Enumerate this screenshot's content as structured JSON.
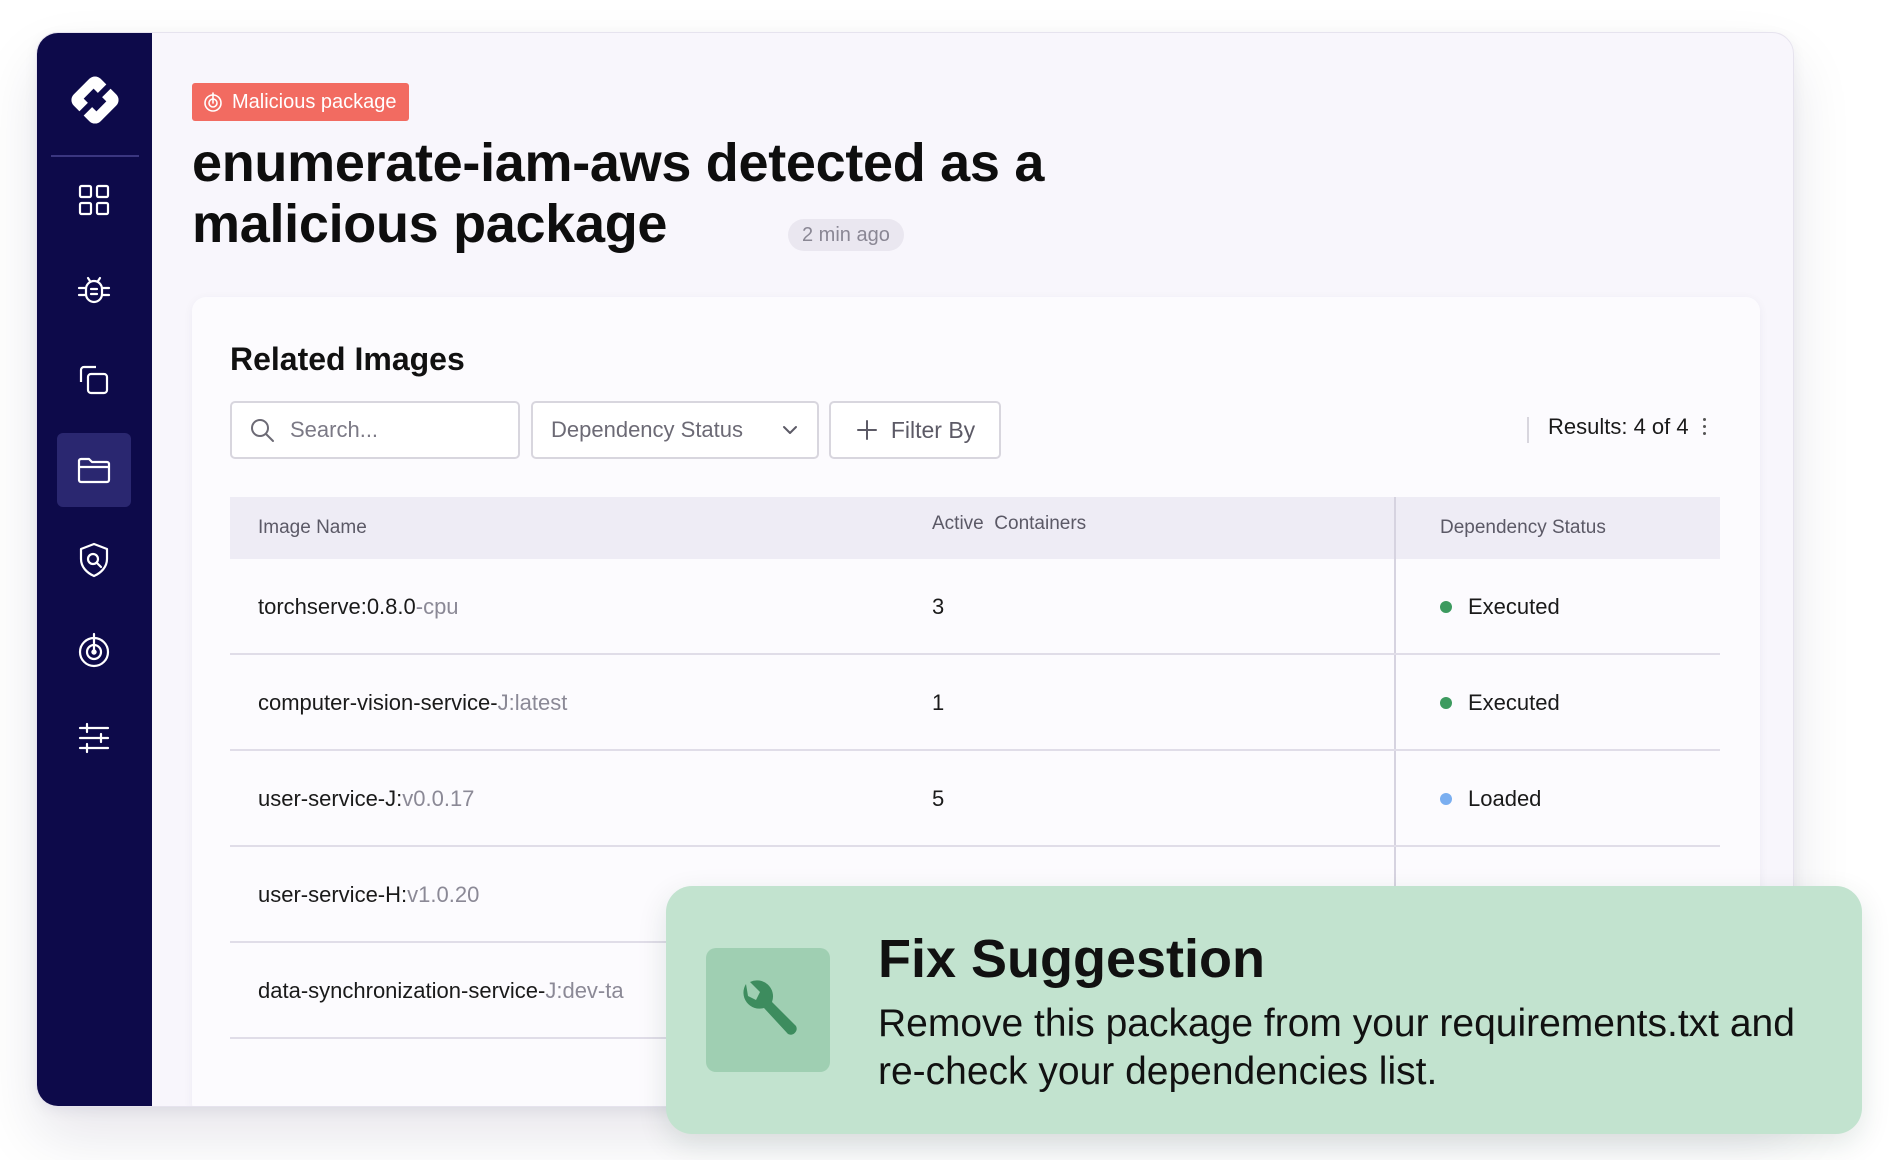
{
  "alert": {
    "badge_label": "Malicious package",
    "title": "enumerate-iam-aws detected as a malicious package",
    "time_ago": "2 min ago"
  },
  "sidebar": {
    "items": [
      {
        "icon": "grid-icon",
        "active": false
      },
      {
        "icon": "bug-icon",
        "active": false
      },
      {
        "icon": "copy-icon",
        "active": false
      },
      {
        "icon": "folder-icon",
        "active": true
      },
      {
        "icon": "shield-search-icon",
        "active": false
      },
      {
        "icon": "target-icon",
        "active": false
      },
      {
        "icon": "sliders-icon",
        "active": false
      }
    ]
  },
  "panel": {
    "title": "Related Images",
    "search_placeholder": "Search...",
    "dropdown_label": "Dependency Status",
    "filter_label": "Filter By",
    "results_text": "Results: 4 of 4"
  },
  "table": {
    "headers": [
      "Image Name",
      "Active  Containers",
      "Dependency Status"
    ],
    "rows": [
      {
        "name": "torchserve:0.8.0",
        "suffix": "-cpu",
        "containers": "3",
        "status": "Executed",
        "status_color": "#3c9a5f"
      },
      {
        "name": "computer-vision-service-",
        "suffix": "J:latest",
        "containers": "1",
        "status": "Executed",
        "status_color": "#3c9a5f"
      },
      {
        "name": "user-service-J:",
        "suffix": "v0.0.17",
        "containers": "5",
        "status": "Loaded",
        "status_color": "#7aaef0"
      },
      {
        "name": "user-service-H:",
        "suffix": "v1.0.20",
        "containers": "",
        "status": "",
        "status_color": ""
      },
      {
        "name": "data-synchronization-service-",
        "suffix": "J:dev-ta",
        "containers": "",
        "status": "",
        "status_color": ""
      }
    ]
  },
  "fix": {
    "title": "Fix Suggestion",
    "text": "Remove this package from your requirements.txt and re-check your dependencies list."
  },
  "colors": {
    "sidebar": "#0d0a4a",
    "badge": "#f26b61",
    "fix_bg": "#c2e3cf"
  }
}
